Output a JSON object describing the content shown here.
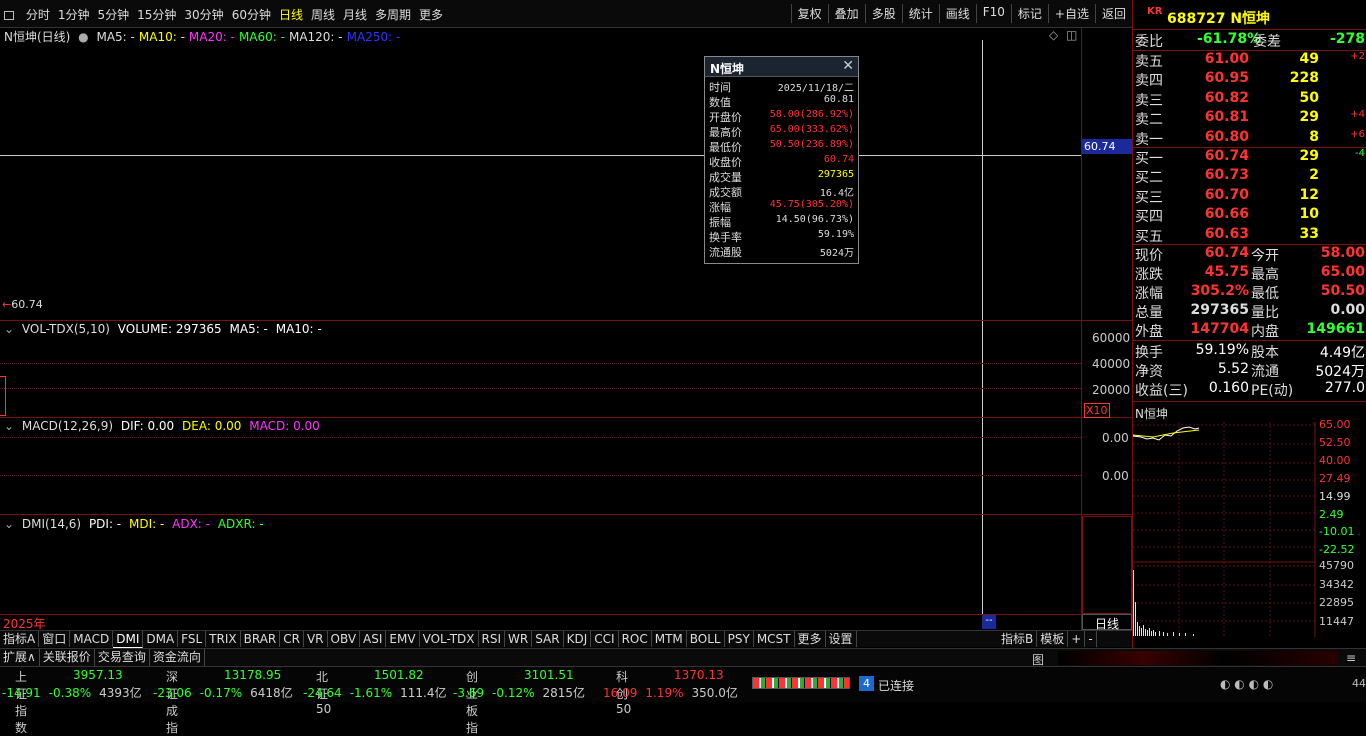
{
  "toolbar": {
    "periods": [
      "分时",
      "1分钟",
      "5分钟",
      "15分钟",
      "30分钟",
      "60分钟",
      "日线",
      "周线",
      "月线",
      "多周期",
      "更多"
    ],
    "active_period": "日线",
    "right_buttons": [
      "复权",
      "叠加",
      "多股",
      "统计",
      "画线",
      "F10",
      "标记",
      "+自选",
      "返回"
    ]
  },
  "chart": {
    "title": "N恒坤(日线)",
    "ma_legend": [
      {
        "label": "MA5: -",
        "color": "#dddddd"
      },
      {
        "label": "MA10: -",
        "color": "#ffff00"
      },
      {
        "label": "MA20: -",
        "color": "#ff33ff"
      },
      {
        "label": "MA60: -",
        "color": "#33ff33"
      },
      {
        "label": "MA120: -",
        "color": "#dddddd"
      },
      {
        "label": "MA250: -",
        "color": "#3333ff"
      }
    ],
    "crosshair_price": "60.74",
    "last_price_marker": "60.74",
    "vol_legend": {
      "name": "VOL-TDX(5,10)",
      "volume": "VOLUME: 297365",
      "ma5": "MA5: -",
      "ma10": "MA10: -"
    },
    "vol_axis": [
      "60000",
      "40000",
      "20000"
    ],
    "vol_unit": "X10",
    "macd_legend": {
      "name": "MACD(12,26,9)",
      "dif": "DIF: 0.00",
      "dea": "DEA: 0.00",
      "macd": "MACD: 0.00"
    },
    "macd_axis": [
      "0.00",
      "0.00"
    ],
    "dmi_legend": {
      "name": "DMI(14,6)",
      "pdi": "PDI: -",
      "mdi": "MDI: -",
      "adx": "ADX: -",
      "adxr": "ADXR: -"
    },
    "year_label": "2025年",
    "cursor_date_label": "--",
    "period_box": "日线"
  },
  "tooltip": {
    "title": "N恒坤",
    "rows": [
      {
        "k": "时间",
        "v": "2025/11/18/二",
        "c": "#dddddd"
      },
      {
        "k": "数值",
        "v": "60.81",
        "c": "#dddddd"
      },
      {
        "k": "开盘价",
        "v": "58.00(286.92%)",
        "c": "#ff3333"
      },
      {
        "k": "最高价",
        "v": "65.00(333.62%)",
        "c": "#ff3333"
      },
      {
        "k": "最低价",
        "v": "50.50(236.89%)",
        "c": "#ff3333"
      },
      {
        "k": "收盘价",
        "v": "60.74",
        "c": "#ff3333"
      },
      {
        "k": "成交量",
        "v": "297365",
        "c": "#ffff00"
      },
      {
        "k": "成交额",
        "v": "16.4亿",
        "c": "#dddddd"
      },
      {
        "k": "涨幅",
        "v": "45.75(305.20%)",
        "c": "#ff3333"
      },
      {
        "k": "振幅",
        "v": "14.50(96.73%)",
        "c": "#dddddd"
      },
      {
        "k": "换手率",
        "v": "59.19%",
        "c": "#dddddd"
      },
      {
        "k": "流通股",
        "v": "5024万",
        "c": "#dddddd"
      }
    ]
  },
  "quote": {
    "badge": "KR",
    "code_name": "688727 N恒坤",
    "weibi_label": "委比",
    "weibi": "-61.78%",
    "weicha_label": "委差",
    "weicha": "-278",
    "asks": [
      {
        "n": "卖五",
        "p": "61.00",
        "v": "49",
        "c": "+2"
      },
      {
        "n": "卖四",
        "p": "60.95",
        "v": "228",
        "c": ""
      },
      {
        "n": "卖三",
        "p": "60.82",
        "v": "50",
        "c": ""
      },
      {
        "n": "卖二",
        "p": "60.81",
        "v": "29",
        "c": "+4"
      },
      {
        "n": "卖一",
        "p": "60.80",
        "v": "8",
        "c": "+6"
      }
    ],
    "bids": [
      {
        "n": "买一",
        "p": "60.74",
        "v": "29",
        "c": "-4"
      },
      {
        "n": "买二",
        "p": "60.73",
        "v": "2",
        "c": ""
      },
      {
        "n": "买三",
        "p": "60.70",
        "v": "12",
        "c": ""
      },
      {
        "n": "买四",
        "p": "60.66",
        "v": "10",
        "c": ""
      },
      {
        "n": "买五",
        "p": "60.63",
        "v": "33",
        "c": ""
      }
    ],
    "stats": [
      {
        "a": "现价",
        "av": "60.74",
        "ac": "#ff3333",
        "b": "今开",
        "bv": "58.00",
        "bc": "#ff3333"
      },
      {
        "a": "涨跌",
        "av": "45.75",
        "ac": "#ff3333",
        "b": "最高",
        "bv": "65.00",
        "bc": "#ff3333"
      },
      {
        "a": "涨幅",
        "av": "305.2%",
        "ac": "#ff3333",
        "b": "最低",
        "bv": "50.50",
        "bc": "#ff3333"
      },
      {
        "a": "总量",
        "av": "297365",
        "ac": "#dddddd",
        "b": "量比",
        "bv": "0.00",
        "bc": "#dddddd"
      },
      {
        "a": "外盘",
        "av": "147704",
        "ac": "#ff3333",
        "b": "内盘",
        "bv": "149661",
        "bc": "#33ff33"
      }
    ],
    "stats2": [
      {
        "a": "换手",
        "av": "59.19%",
        "b": "股本",
        "bv": "4.49亿"
      },
      {
        "a": "净资",
        "av": "5.52",
        "b": "流通",
        "bv": "5024万"
      },
      {
        "a": "收益(三)",
        "av": "0.160",
        "b": "PE(动)",
        "bv": "277.0"
      }
    ],
    "mini_title": "N恒坤",
    "mini_price_axis": [
      {
        "v": "65.00",
        "c": "#ff3333"
      },
      {
        "v": "52.50",
        "c": "#ff3333"
      },
      {
        "v": "40.00",
        "c": "#ff3333"
      },
      {
        "v": "27.49",
        "c": "#ff3333"
      },
      {
        "v": "14.99",
        "c": "#dddddd"
      },
      {
        "v": "2.49",
        "c": "#33ff33"
      },
      {
        "v": "-10.01",
        "c": "#33ff33"
      },
      {
        "v": "-22.52",
        "c": "#33ff33"
      }
    ],
    "mini_vol_axis": [
      "45790",
      "34342",
      "22895",
      "11447"
    ]
  },
  "bottom_tabs": [
    "指标A",
    "窗口",
    "MACD",
    "DMI",
    "DMA",
    "FSL",
    "TRIX",
    "BRAR",
    "CR",
    "VR",
    "OBV",
    "ASI",
    "EMV",
    "VOL-TDX",
    "RSI",
    "WR",
    "SAR",
    "KDJ",
    "CCI",
    "ROC",
    "MTM",
    "BOLL",
    "PSY",
    "MCST",
    "更多",
    "设置"
  ],
  "active_tab": "DMI",
  "bottom_right_tabs": [
    "指标B",
    "模板",
    "+",
    "-"
  ],
  "sub_tabs": [
    "扩展∧",
    "关联报价",
    "交易查询",
    "资金流向"
  ],
  "indices": [
    {
      "name": "上证指数",
      "value": "3957.13",
      "chg": "-14.91",
      "pct": "-0.38%",
      "amt": "4393亿"
    },
    {
      "name": "深证成指",
      "value": "13178.95",
      "chg": "-23.06",
      "pct": "-0.17%",
      "amt": "6418亿"
    },
    {
      "name": "北证50",
      "value": "1501.82",
      "chg": "-24.64",
      "pct": "-1.61%",
      "amt": "111.4亿"
    },
    {
      "name": "创业板指",
      "value": "3101.51",
      "chg": "-3.69",
      "pct": "-0.12%",
      "amt": "2815亿"
    },
    {
      "name": "科创50",
      "value": "1370.13",
      "chg": "16.09",
      "pct": "1.19%",
      "amt": "350.0亿"
    }
  ],
  "connection": {
    "count": "4",
    "label": "已连接"
  },
  "status_clock": "44"
}
